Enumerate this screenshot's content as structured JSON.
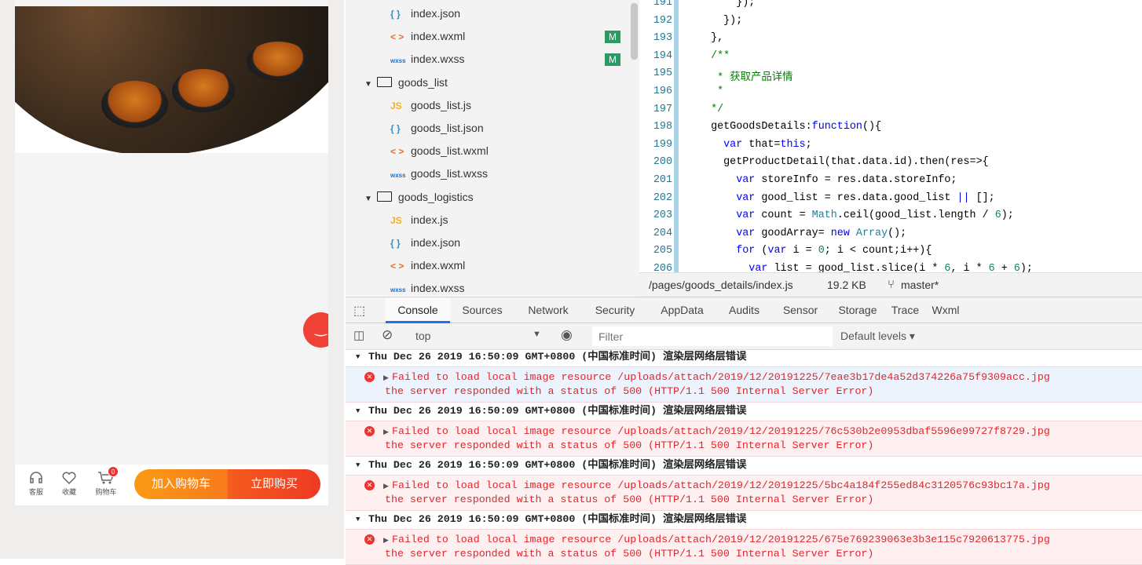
{
  "simulator": {
    "fab_icon": "smile-icon",
    "bottom_bar": {
      "service": "客服",
      "favorite": "收藏",
      "cart": "购物车",
      "cart_count": "0",
      "add_to_cart": "加入购物车",
      "buy_now": "立即购买"
    }
  },
  "file_tree": [
    {
      "icon": "json",
      "name": "index.json",
      "indent": 1
    },
    {
      "icon": "wxml",
      "name": "index.wxml",
      "indent": 1,
      "badge": "M"
    },
    {
      "icon": "wxss",
      "name": "index.wxss",
      "indent": 1,
      "badge": "M"
    },
    {
      "icon": "folder",
      "name": "goods_list",
      "indent": 0
    },
    {
      "icon": "js",
      "name": "goods_list.js",
      "indent": 1
    },
    {
      "icon": "json",
      "name": "goods_list.json",
      "indent": 1
    },
    {
      "icon": "wxml",
      "name": "goods_list.wxml",
      "indent": 1
    },
    {
      "icon": "wxss",
      "name": "goods_list.wxss",
      "indent": 1
    },
    {
      "icon": "folder",
      "name": "goods_logistics",
      "indent": 0
    },
    {
      "icon": "js",
      "name": "index.js",
      "indent": 1
    },
    {
      "icon": "json",
      "name": "index.json",
      "indent": 1
    },
    {
      "icon": "wxml",
      "name": "index.wxml",
      "indent": 1
    },
    {
      "icon": "wxss",
      "name": "index.wxss",
      "indent": 1
    }
  ],
  "icon_glyphs": {
    "json": "{ }",
    "wxml": "< >",
    "wxss": "wxss",
    "js": "JS"
  },
  "colors": {
    "json": "#1e9bd7",
    "wxml": "#e0702a",
    "wxss": "#1e6fc0",
    "js": "#f0b020",
    "accent": "#1a73e8",
    "error": "#e0262b"
  },
  "editor": {
    "lines": [
      {
        "n": "191",
        "t": [
          [
            "p",
            "      });"
          ]
        ]
      },
      {
        "n": "192",
        "t": [
          [
            "p",
            "    });"
          ]
        ]
      },
      {
        "n": "193",
        "t": [
          [
            "p",
            "  },"
          ]
        ]
      },
      {
        "n": "194",
        "t": [
          [
            "cm",
            "  /**"
          ]
        ]
      },
      {
        "n": "195",
        "t": [
          [
            "cm",
            "   * 获取产品详情"
          ]
        ]
      },
      {
        "n": "196",
        "t": [
          [
            "cm",
            "   *"
          ]
        ]
      },
      {
        "n": "197",
        "t": [
          [
            "cm",
            "  */"
          ]
        ]
      },
      {
        "n": "198",
        "t": [
          [
            "p",
            "  getGoodsDetails:"
          ],
          [
            "kw",
            "function"
          ],
          [
            "p",
            "(){"
          ]
        ]
      },
      {
        "n": "199",
        "t": [
          [
            "kw",
            "    var"
          ],
          [
            "p",
            " that="
          ],
          [
            "kw",
            "this"
          ],
          [
            "p",
            ";"
          ]
        ]
      },
      {
        "n": "200",
        "t": [
          [
            "p",
            "    getProductDetail(that.data.id).then(res=>{"
          ]
        ]
      },
      {
        "n": "201",
        "t": [
          [
            "kw",
            "      var"
          ],
          [
            "p",
            " storeInfo = res.data.storeInfo;"
          ]
        ]
      },
      {
        "n": "202",
        "t": [
          [
            "kw",
            "      var"
          ],
          [
            "p",
            " good_list = res.data.good_list "
          ],
          [
            "kw",
            "||"
          ],
          [
            "p",
            " [];"
          ]
        ]
      },
      {
        "n": "203",
        "t": [
          [
            "kw",
            "      var"
          ],
          [
            "p",
            " count = "
          ],
          [
            "ty",
            "Math"
          ],
          [
            "p",
            ".ceil(good_list.length / "
          ],
          [
            "nu",
            "6"
          ],
          [
            "p",
            ");"
          ]
        ]
      },
      {
        "n": "204",
        "t": [
          [
            "kw",
            "      var"
          ],
          [
            "p",
            " goodArray= "
          ],
          [
            "kw",
            "new"
          ],
          [
            "p",
            " "
          ],
          [
            "ty",
            "Array"
          ],
          [
            "p",
            "();"
          ]
        ]
      },
      {
        "n": "205",
        "t": [
          [
            "kw",
            "      for"
          ],
          [
            "p",
            " ("
          ],
          [
            "kw",
            "var"
          ],
          [
            "p",
            " i = "
          ],
          [
            "nu",
            "0"
          ],
          [
            "p",
            "; i < count;i++){"
          ]
        ]
      },
      {
        "n": "206",
        "t": [
          [
            "kw",
            "        var"
          ],
          [
            "p",
            " list = good_list.slice(i * "
          ],
          [
            "nu",
            "6"
          ],
          [
            "p",
            ", i * "
          ],
          [
            "nu",
            "6"
          ],
          [
            "p",
            " + "
          ],
          [
            "nu",
            "6"
          ],
          [
            "p",
            ");"
          ]
        ]
      }
    ]
  },
  "status": {
    "path": "/pages/goods_details/index.js",
    "size": "19.2 KB",
    "branch": "master*"
  },
  "devtools": {
    "tabs": [
      "Console",
      "Sources",
      "Network",
      "Security",
      "AppData",
      "Audits",
      "Sensor",
      "Storage",
      "Trace",
      "Wxml"
    ],
    "active_tab": "Console",
    "context": "top",
    "filter_placeholder": "Filter",
    "levels": "Default levels"
  },
  "console": [
    {
      "group": "Thu Dec 26 2019 16:50:09 GMT+0800 (中国标准时间) 渲染层网络层错误",
      "line1": "Failed to load local image resource /uploads/attach/2019/12/20191225/7eae3b17de4a52d374226a75f9309acc.jpg",
      "line2": "the server responded with a status of 500 (HTTP/1.1 500 Internal Server Error)"
    },
    {
      "group": "Thu Dec 26 2019 16:50:09 GMT+0800 (中国标准时间) 渲染层网络层错误",
      "line1": "Failed to load local image resource /uploads/attach/2019/12/20191225/76c530b2e0953dbaf5596e99727f8729.jpg",
      "line2": "the server responded with a status of 500 (HTTP/1.1 500 Internal Server Error)"
    },
    {
      "group": "Thu Dec 26 2019 16:50:09 GMT+0800 (中国标准时间) 渲染层网络层错误",
      "line1": "Failed to load local image resource /uploads/attach/2019/12/20191225/5bc4a184f255ed84c3120576c93bc17a.jpg",
      "line2": "the server responded with a status of 500 (HTTP/1.1 500 Internal Server Error)"
    },
    {
      "group": "Thu Dec 26 2019 16:50:09 GMT+0800 (中国标准时间) 渲染层网络层错误",
      "line1": "Failed to load local image resource /uploads/attach/2019/12/20191225/675e769239063e3b3e115c7920613775.jpg",
      "line2": "the server responded with a status of 500 (HTTP/1.1 500 Internal Server Error)"
    }
  ]
}
